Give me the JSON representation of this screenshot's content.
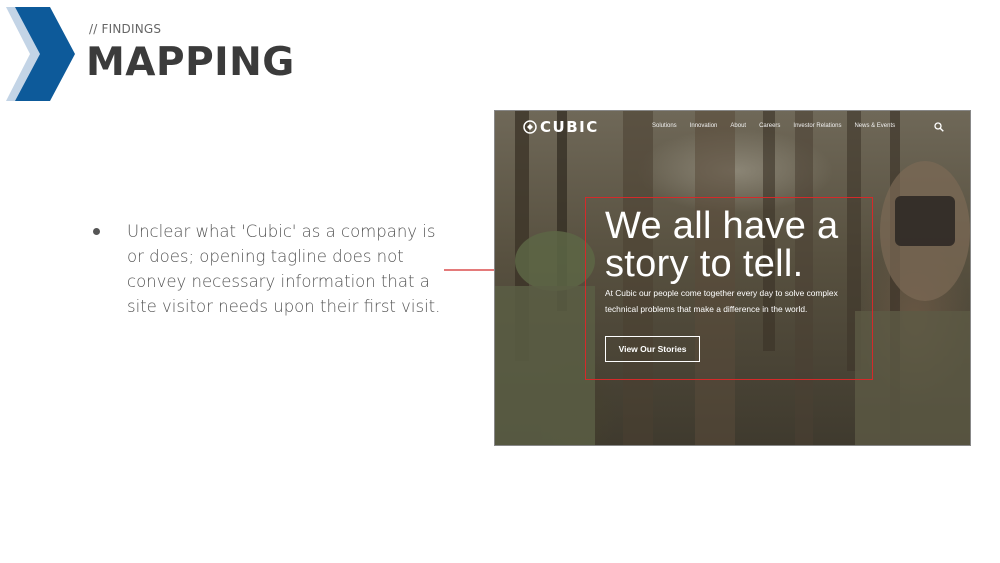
{
  "header": {
    "kicker": "// FINDINGS",
    "title": "MAPPING"
  },
  "finding": {
    "text": "Unclear what 'Cubic' as a company is or does; opening tagline does not convey necessary information that a site visitor needs upon their first visit."
  },
  "colors": {
    "chevron_dark": "#0d5a9a",
    "chevron_light": "#c3d4e6",
    "title": "#3b3b3b",
    "annotation": "#d42a2a"
  },
  "screenshot": {
    "logo": "CUBIC",
    "nav": [
      "Solutions",
      "Innovation",
      "About",
      "Careers",
      "Investor Relations",
      "News & Events"
    ],
    "search_icon": "search-icon",
    "headline": "We all have a story to tell.",
    "subtext": "At Cubic our people come together every day to solve complex technical problems that make a difference in the world.",
    "cta": "View Our Stories"
  }
}
